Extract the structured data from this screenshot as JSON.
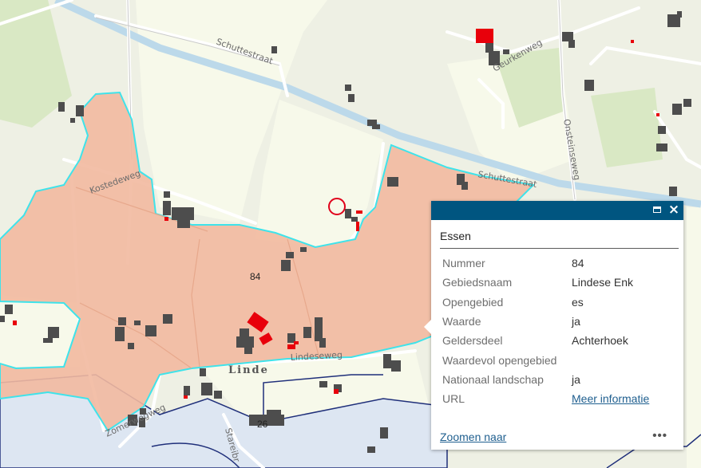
{
  "map": {
    "labels": {
      "street_schuttestraat_1": "Schuttestraat",
      "street_geurkenweg": "Geurkenweg",
      "street_onsteinseweg": "Onsteinseweg",
      "street_schuttestraat_2": "Schuttestraat",
      "street_kostedeweg": "Kostedeweg",
      "street_lindeseweg": "Lindeseweg",
      "street_zomerweg": "Zomerwegweg",
      "street_stareibr": "Stareibr",
      "plot_84": "84",
      "plot_26": "26",
      "place_linde": "Linde"
    },
    "colors": {
      "background": "#eef0e4",
      "field": "#f7f9ea",
      "essen_fill": "#f2b9a0",
      "essen_outline": "#3fe3ea",
      "canal": "#bcd9ea",
      "neighbour_fill": "#dde6f2",
      "neighbour_outline": "#1f2f7a",
      "building": "#4d4d4d",
      "highlight_building": "#e8000b",
      "marker": "#e0001b"
    }
  },
  "popup": {
    "title": "Essen",
    "maximize_icon": "maximize-icon",
    "close_icon": "close-icon",
    "rows": [
      {
        "key": "Nummer",
        "value": "84"
      },
      {
        "key": "Gebiedsnaam",
        "value": "Lindese Enk"
      },
      {
        "key": "Opengebied",
        "value": "es"
      },
      {
        "key": "Waarde",
        "value": "ja"
      },
      {
        "key": "Geldersdeel",
        "value": "Achterhoek"
      },
      {
        "key": "Waardevol opengebied",
        "value": ""
      },
      {
        "key": "Nationaal landschap",
        "value": "ja"
      },
      {
        "key": "URL",
        "value": "Meer informatie"
      }
    ],
    "zoom_link": "Zoomen naar",
    "more": "•••"
  }
}
